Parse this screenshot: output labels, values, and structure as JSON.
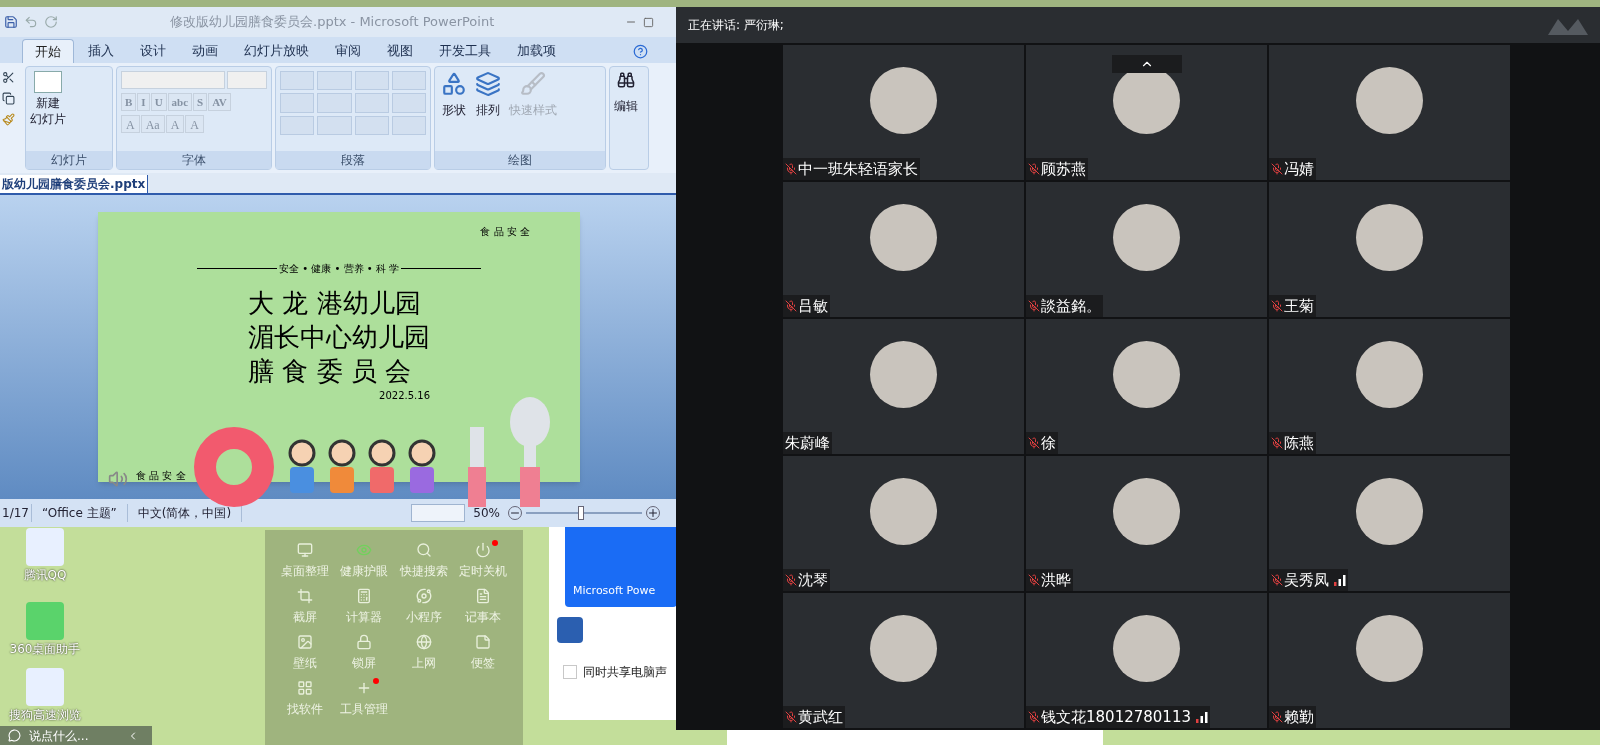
{
  "desktop": {
    "icons": [
      {
        "label": "腾讯QQ"
      },
      {
        "label": "360桌面助手"
      },
      {
        "label": "搜狗高速浏览"
      }
    ],
    "chat_bar": {
      "placeholder": "说点什么..."
    },
    "toolbox": {
      "items": [
        {
          "label": "桌面整理",
          "kind": "monitor",
          "badge": false
        },
        {
          "label": "健康护眼",
          "kind": "eye",
          "badge": false
        },
        {
          "label": "快捷搜索",
          "kind": "search",
          "badge": false
        },
        {
          "label": "定时关机",
          "kind": "power",
          "badge": true
        },
        {
          "label": "截屏",
          "kind": "crop",
          "badge": false
        },
        {
          "label": "计算器",
          "kind": "calc",
          "badge": false
        },
        {
          "label": "小程序",
          "kind": "mini",
          "badge": false
        },
        {
          "label": "记事本",
          "kind": "note",
          "badge": false
        },
        {
          "label": "壁纸",
          "kind": "image",
          "badge": false
        },
        {
          "label": "锁屏",
          "kind": "lock",
          "badge": false
        },
        {
          "label": "上网",
          "kind": "globe",
          "badge": false
        },
        {
          "label": "便签",
          "kind": "sticky",
          "badge": false
        },
        {
          "label": "找软件",
          "kind": "apps",
          "badge": false
        },
        {
          "label": "工具管理",
          "kind": "plus",
          "badge": true
        }
      ]
    },
    "share_panel": {
      "thumbnail_title": "Microsoft Powe",
      "share_audio": {
        "label": "同时共享电脑声",
        "checked": false
      }
    }
  },
  "powerpoint": {
    "title": "修改版幼儿园膳食委员会.pptx - Microsoft PowerPoint",
    "tabs": [
      {
        "label": "开始",
        "selected": true
      },
      {
        "label": "插入",
        "selected": false
      },
      {
        "label": "设计",
        "selected": false
      },
      {
        "label": "动画",
        "selected": false
      },
      {
        "label": "幻灯片放映",
        "selected": false
      },
      {
        "label": "审阅",
        "selected": false
      },
      {
        "label": "视图",
        "selected": false
      },
      {
        "label": "开发工具",
        "selected": false
      },
      {
        "label": "加载项",
        "selected": false
      }
    ],
    "groups": {
      "slides": {
        "label": "幻灯片",
        "new_slide": [
          "新建",
          "幻灯片"
        ]
      },
      "font": {
        "label": "字体",
        "buttons": [
          "B",
          "I",
          "U",
          "abc",
          "S",
          "AV"
        ],
        "size_buttons": [
          "A",
          "Aa",
          "A",
          "A"
        ]
      },
      "paragraph": {
        "label": "段落"
      },
      "drawing": {
        "label": "绘图",
        "buttons": [
          {
            "label": "形状",
            "disabled": false
          },
          {
            "label": "排列",
            "disabled": false
          },
          {
            "label": "快速样式",
            "disabled": true
          }
        ]
      },
      "editing": {
        "label": "编辑"
      }
    },
    "document_tab": "版幼儿园膳食委员会.pptx",
    "slide": {
      "top_tag": "食 品 安 全",
      "motto": "安全 • 健康 • 营养 • 科 学",
      "title_lines": [
        "大 龙 港幼儿园",
        "湄长中心幼儿园",
        "膳 食 委 员 会"
      ],
      "date": "2022.5.16",
      "bottom_tag": "食 品 安 全"
    },
    "status_bar": {
      "slide": "1/17",
      "theme": "“Office 主题”",
      "language": "中文(简体，中国)",
      "zoom": "50%",
      "level": 0.45
    }
  },
  "meeting": {
    "speaking": "正在讲话: 严衍琳;",
    "participants": [
      {
        "name": "中一班朱轻语家长",
        "muted": true,
        "signal": false
      },
      {
        "name": "顾苏燕",
        "muted": true,
        "signal": false
      },
      {
        "name": "冯婧",
        "muted": true,
        "signal": false
      },
      {
        "name": "吕敏",
        "muted": true,
        "signal": false
      },
      {
        "name": "談益銘。",
        "muted": true,
        "signal": false
      },
      {
        "name": "王菊",
        "muted": true,
        "signal": false
      },
      {
        "name": "朱蔚峰",
        "muted": false,
        "signal": false
      },
      {
        "name": "徐",
        "muted": true,
        "signal": false
      },
      {
        "name": "陈燕",
        "muted": true,
        "signal": false
      },
      {
        "name": "沈琴",
        "muted": true,
        "signal": false
      },
      {
        "name": "洪晔",
        "muted": true,
        "signal": false
      },
      {
        "name": "吴秀凤",
        "muted": true,
        "signal": true
      },
      {
        "name": "黄武红",
        "muted": true,
        "signal": false
      },
      {
        "name": "钱文花18012780113",
        "muted": true,
        "signal": true
      },
      {
        "name": "赖勤",
        "muted": true,
        "signal": false
      }
    ]
  }
}
